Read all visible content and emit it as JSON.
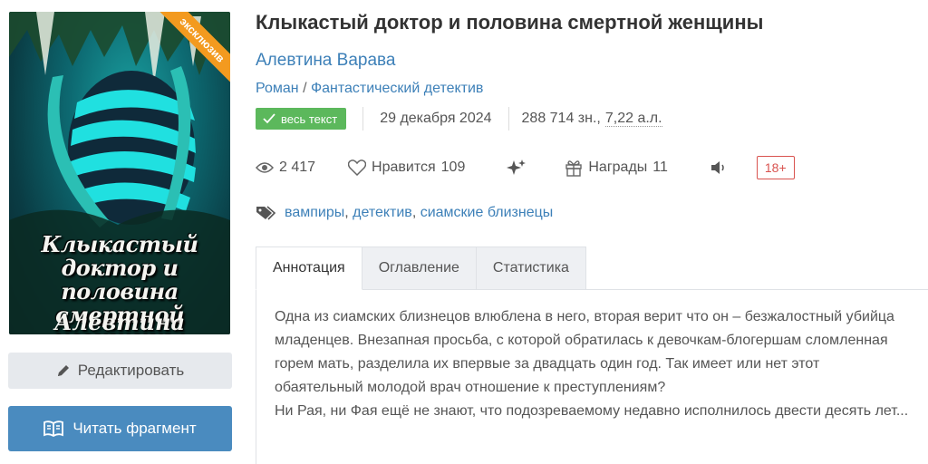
{
  "cover": {
    "title_text": "Клыкастый доктор и половина смертной женщины",
    "author_text": "Алевтина Варава",
    "ribbon": "эксклюзив"
  },
  "buttons": {
    "edit_label": "Редактировать",
    "read_label": "Читать фрагмент"
  },
  "book": {
    "title": "Клыкастый доктор и половина смертной женщины",
    "author": "Алевтина Варава",
    "genre_primary": "Роман",
    "genre_separator": "/",
    "genre_secondary": "Фантастический детектив",
    "badge": "весь текст",
    "date": "29 декабря 2024",
    "size_chars": "288 714 зн.,",
    "size_sheets": "7,22 а.л."
  },
  "stats": {
    "views": "2 417",
    "likes_label": "Нравится",
    "likes": "109",
    "awards_label": "Награды",
    "awards": "11",
    "age": "18+"
  },
  "tags": [
    "вампиры",
    "детектив",
    "сиамские близнецы"
  ],
  "tabs": [
    {
      "label": "Аннотация",
      "active": true
    },
    {
      "label": "Оглавление",
      "active": false
    },
    {
      "label": "Статистика",
      "active": false
    }
  ],
  "annotation": {
    "paragraph1": "Одна из сиамских близнецов влюблена в него, вторая верит что он – безжалостный убийца младенцев. Внезапная просьба, с которой обратилась к девочкам-блогершам сломленная горем мать, разделила их впервые за двадцать один год. Так имеет или нет этот обаятельный молодой врач отношение к преступлениям?",
    "paragraph2": "Ни Рая, ни Фая ещё не знают, что подозреваемому недавно исполнилось двести десять лет..."
  },
  "colors": {
    "link": "#3d80b8",
    "badge_green": "#5cb85c",
    "age_red": "#d9534f",
    "read_button": "#4a8bbf",
    "ribbon_orange": "#f39a1f"
  }
}
